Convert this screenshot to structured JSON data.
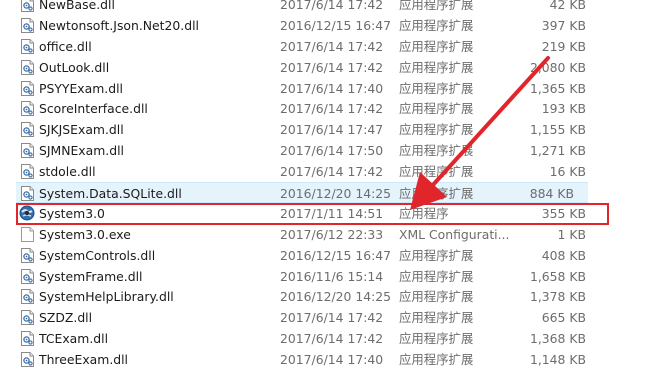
{
  "files": [
    {
      "name": "NewBase.dll",
      "date": "2017/6/14 17:42",
      "type": "应用程序扩展",
      "size": "42 KB",
      "icon": "dll-icon"
    },
    {
      "name": "Newtonsoft.Json.Net20.dll",
      "date": "2016/12/15 16:47",
      "type": "应用程序扩展",
      "size": "397 KB",
      "icon": "dll-icon"
    },
    {
      "name": "office.dll",
      "date": "2017/6/14 17:42",
      "type": "应用程序扩展",
      "size": "219 KB",
      "icon": "dll-icon"
    },
    {
      "name": "OutLook.dll",
      "date": "2017/6/14 17:42",
      "type": "应用程序扩展",
      "size": "2,080 KB",
      "icon": "dll-icon"
    },
    {
      "name": "PSYYExam.dll",
      "date": "2017/6/14 17:40",
      "type": "应用程序扩展",
      "size": "1,365 KB",
      "icon": "dll-icon"
    },
    {
      "name": "ScoreInterface.dll",
      "date": "2017/6/14 17:42",
      "type": "应用程序扩展",
      "size": "193 KB",
      "icon": "dll-icon"
    },
    {
      "name": "SJKJSExam.dll",
      "date": "2017/6/14 17:47",
      "type": "应用程序扩展",
      "size": "1,155 KB",
      "icon": "dll-icon"
    },
    {
      "name": "SJMNExam.dll",
      "date": "2017/6/14 17:50",
      "type": "应用程序扩展",
      "size": "1,271 KB",
      "icon": "dll-icon"
    },
    {
      "name": "stdole.dll",
      "date": "2017/6/14 17:42",
      "type": "应用程序扩展",
      "size": "16 KB",
      "icon": "dll-icon"
    },
    {
      "name": "System.Data.SQLite.dll",
      "date": "2016/12/20 14:25",
      "type": "应用程序扩展",
      "size": "884 KB",
      "icon": "dll-icon"
    },
    {
      "name": "System3.0",
      "date": "2017/1/11 14:51",
      "type": "应用程序",
      "size": "355 KB",
      "icon": "app-globe-icon"
    },
    {
      "name": "System3.0.exe",
      "date": "2017/6/12 22:33",
      "type": "XML Configurati...",
      "size": "1 KB",
      "icon": "config-file-icon"
    },
    {
      "name": "SystemControls.dll",
      "date": "2016/12/15 16:47",
      "type": "应用程序扩展",
      "size": "408 KB",
      "icon": "dll-icon"
    },
    {
      "name": "SystemFrame.dll",
      "date": "2016/11/6 15:14",
      "type": "应用程序扩展",
      "size": "1,658 KB",
      "icon": "dll-icon"
    },
    {
      "name": "SystemHelpLibrary.dll",
      "date": "2016/12/20 14:25",
      "type": "应用程序扩展",
      "size": "1,378 KB",
      "icon": "dll-icon"
    },
    {
      "name": "SZDZ.dll",
      "date": "2017/6/14 17:42",
      "type": "应用程序扩展",
      "size": "665 KB",
      "icon": "dll-icon"
    },
    {
      "name": "TCExam.dll",
      "date": "2017/6/14 17:42",
      "type": "应用程序扩展",
      "size": "1,368 KB",
      "icon": "dll-icon"
    },
    {
      "name": "ThreeExam.dll",
      "date": "2017/6/14 17:40",
      "type": "应用程序扩展",
      "size": "1,148 KB",
      "icon": "dll-icon"
    }
  ],
  "hover_index": 9,
  "highlight_index": 10,
  "colors": {
    "highlight": "#e0262a",
    "hover_bg": "#e5f3fb",
    "dll_icon": "#3a6ea8"
  }
}
